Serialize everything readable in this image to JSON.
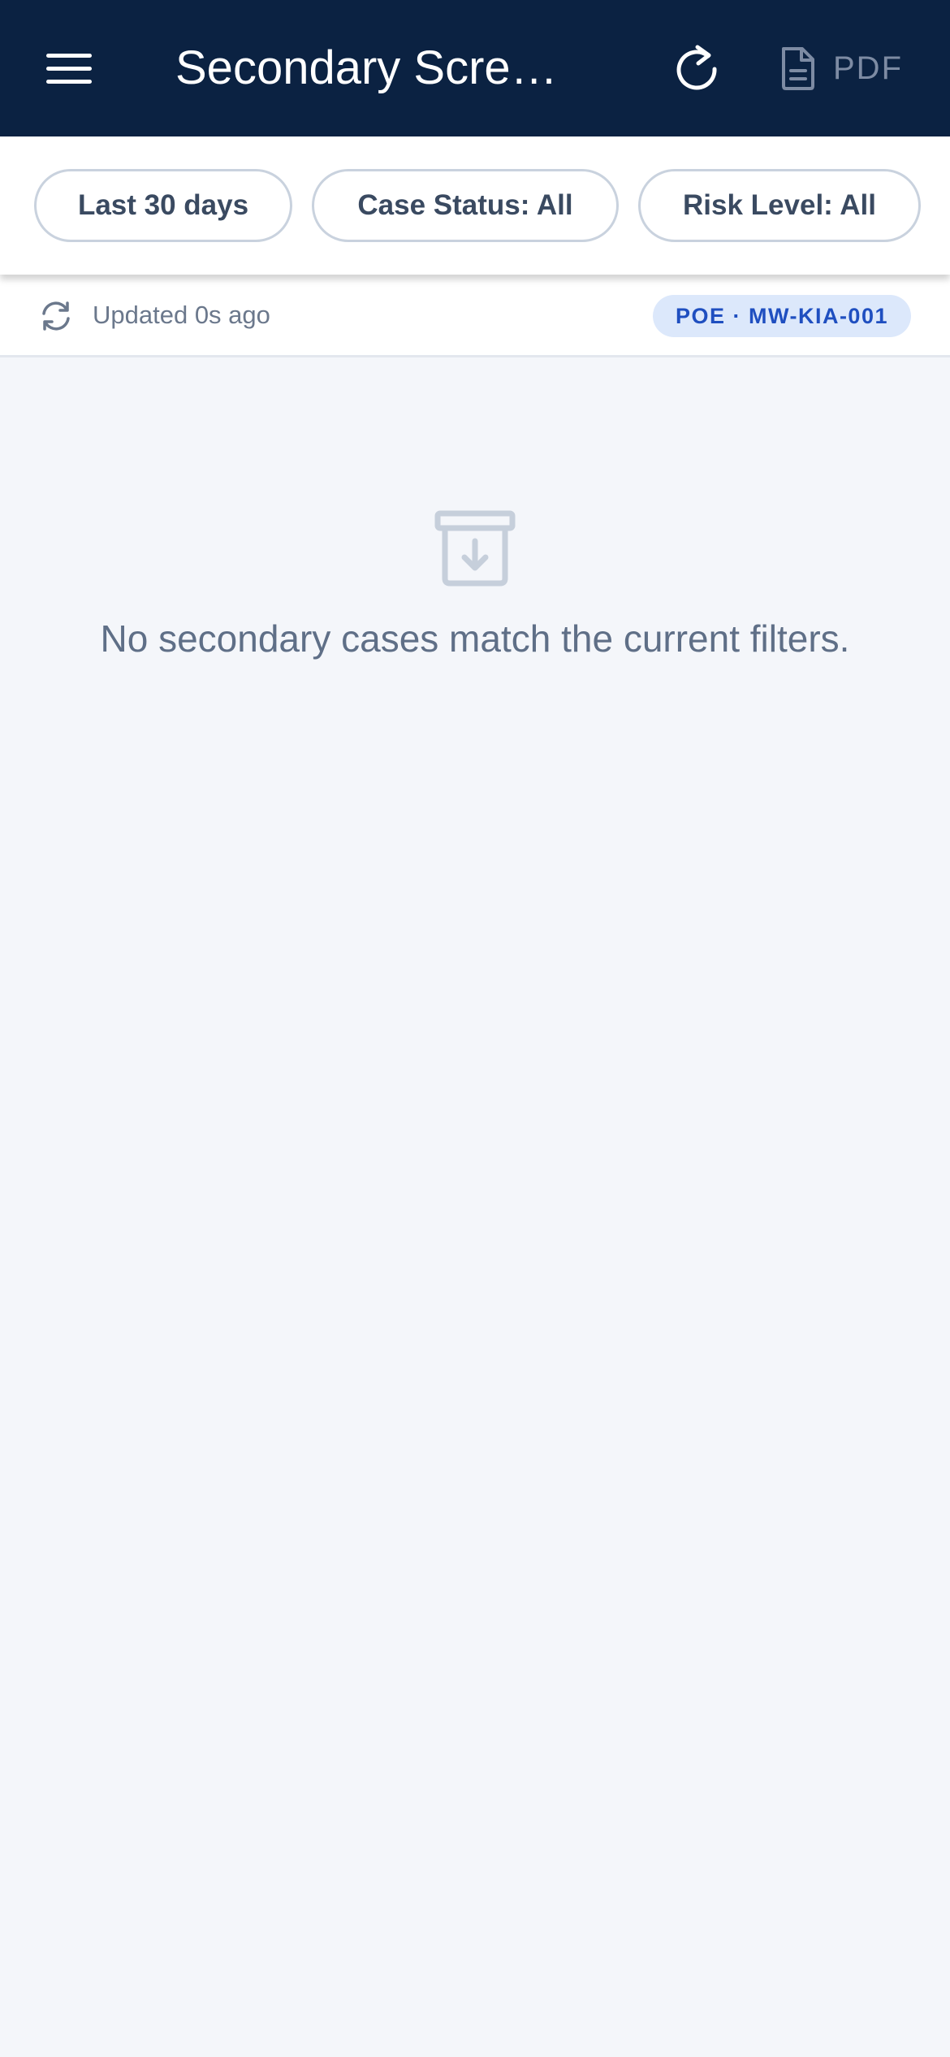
{
  "header": {
    "title": "Secondary Scre…",
    "menu_icon": "hamburger-menu-icon",
    "refresh_icon": "refresh-icon",
    "pdf_icon": "document-icon",
    "pdf_label": "PDF"
  },
  "filters": [
    {
      "label": "Last 30 days"
    },
    {
      "label": "Case Status: All"
    },
    {
      "label": "Risk Level: All"
    }
  ],
  "status": {
    "updated_text": "Updated 0s ago",
    "sync_icon": "sync-icon",
    "poe_badge": "POE · MW-KIA-001"
  },
  "empty_state": {
    "icon": "archive-icon",
    "message": "No secondary cases match the current filters."
  },
  "colors": {
    "header_bg": "#0b2242",
    "page_bg": "#f4f6fa",
    "badge_bg": "#dce8fb",
    "badge_text": "#1f4fc0",
    "chip_border": "#c9d2de"
  }
}
